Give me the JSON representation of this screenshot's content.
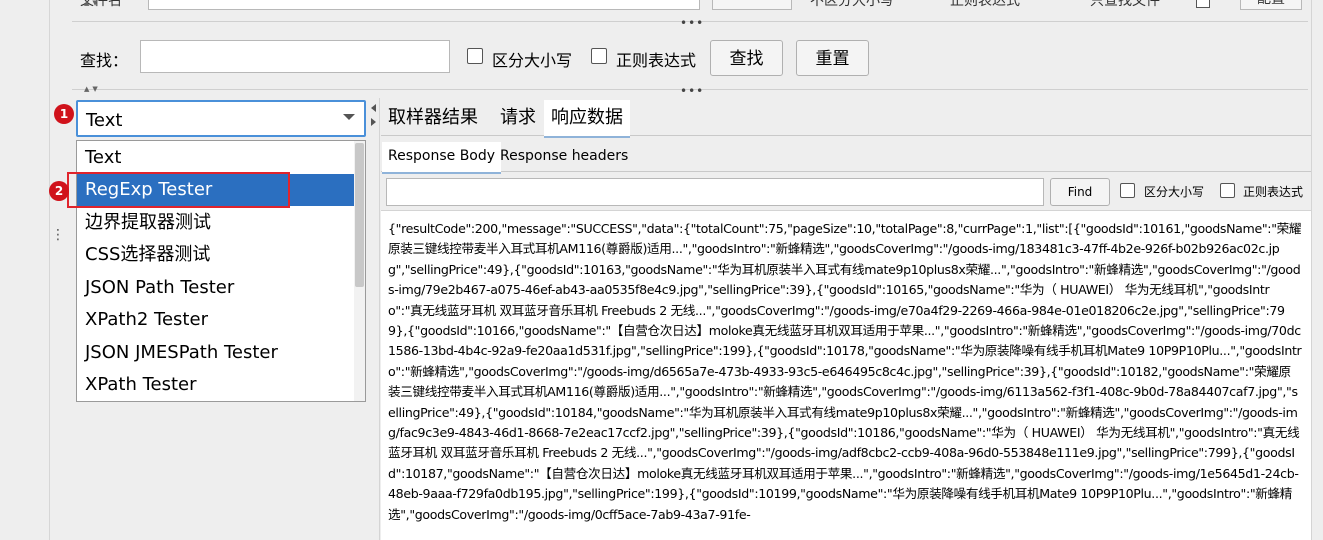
{
  "top_row": {
    "cut_label_1": "文件名",
    "cut_label_2": "不区分大小写",
    "cut_label_3": "正则表达式",
    "cut_label_4": "只查找文件",
    "cut_button": "配置"
  },
  "search": {
    "label": "查找：",
    "input_value": "",
    "case_label": "区分大小写",
    "regex_label": "正则表达式",
    "find_button": "查找",
    "reset_button": "重置"
  },
  "renderer_select": {
    "selected": "Text",
    "options": [
      "Text",
      "RegExp Tester",
      "边界提取器测试",
      "CSS选择器测试",
      "JSON Path Tester",
      "XPath2 Tester",
      "JSON JMESPath Tester",
      "XPath Tester"
    ],
    "highlighted_index": 1
  },
  "annotations": {
    "badge_1": "1",
    "badge_2": "2",
    "color_marker": "#e0242c"
  },
  "tabs": [
    {
      "label": "取样器结果",
      "active": false
    },
    {
      "label": "请求",
      "active": false
    },
    {
      "label": "响应数据",
      "active": true
    }
  ],
  "subtabs": [
    {
      "label": "Response Body",
      "active": true
    },
    {
      "label": "Response headers",
      "active": false
    }
  ],
  "response_find": {
    "input_value": "",
    "find_button": "Find",
    "case_label": "区分大小写",
    "regex_label": "正则表达式"
  },
  "response_body": "{\"resultCode\":200,\"message\":\"SUCCESS\",\"data\":{\"totalCount\":75,\"pageSize\":10,\"totalPage\":8,\"currPage\":1,\"list\":[{\"goodsId\":10161,\"goodsName\":\"荣耀原装三键线控带麦半入耳式耳机AM116(尊爵版)适用...\",\"goodsIntro\":\"新蜂精选\",\"goodsCoverImg\":\"/goods-img/183481c3-47ff-4b2e-926f-b02b926ac02c.jpg\",\"sellingPrice\":49},{\"goodsId\":10163,\"goodsName\":\"华为耳机原装半入耳式有线mate9p10plus8x荣耀...\",\"goodsIntro\":\"新蜂精选\",\"goodsCoverImg\":\"/goods-img/79e2b467-a075-46ef-ab43-aa0535f8e4c9.jpg\",\"sellingPrice\":39},{\"goodsId\":10165,\"goodsName\":\"华为（ HUAWEI） 华为无线耳机\",\"goodsIntro\":\"真无线蓝牙耳机 双耳蓝牙音乐耳机 Freebuds 2 无线...\",\"goodsCoverImg\":\"/goods-img/e70a4f29-2269-466a-984e-01e018206c2e.jpg\",\"sellingPrice\":799},{\"goodsId\":10166,\"goodsName\":\"【自营仓次日达】moloke真无线蓝牙耳机双耳适用于苹果...\",\"goodsIntro\":\"新蜂精选\",\"goodsCoverImg\":\"/goods-img/70dc1586-13bd-4b4c-92a9-fe20aa1d531f.jpg\",\"sellingPrice\":199},{\"goodsId\":10178,\"goodsName\":\"华为原装降噪有线手机耳机Mate9 10P9P10Plu...\",\"goodsIntro\":\"新蜂精选\",\"goodsCoverImg\":\"/goods-img/d6565a7e-473b-4933-93c5-e646495c8c4c.jpg\",\"sellingPrice\":39},{\"goodsId\":10182,\"goodsName\":\"荣耀原装三键线控带麦半入耳式耳机AM116(尊爵版)适用...\",\"goodsIntro\":\"新蜂精选\",\"goodsCoverImg\":\"/goods-img/6113a562-f3f1-408c-9b0d-78a84407caf7.jpg\",\"sellingPrice\":49},{\"goodsId\":10184,\"goodsName\":\"华为耳机原装半入耳式有线mate9p10plus8x荣耀...\",\"goodsIntro\":\"新蜂精选\",\"goodsCoverImg\":\"/goods-img/fac9c3e9-4843-46d1-8668-7e2eac17ccf2.jpg\",\"sellingPrice\":39},{\"goodsId\":10186,\"goodsName\":\"华为（ HUAWEI） 华为无线耳机\",\"goodsIntro\":\"真无线蓝牙耳机 双耳蓝牙音乐耳机 Freebuds 2 无线...\",\"goodsCoverImg\":\"/goods-img/adf8cbc2-ccb9-408a-96d0-553848e111e9.jpg\",\"sellingPrice\":799},{\"goodsId\":10187,\"goodsName\":\"【自营仓次日达】moloke真无线蓝牙耳机双耳适用于苹果...\",\"goodsIntro\":\"新蜂精选\",\"goodsCoverImg\":\"/goods-img/1e5645d1-24cb-48eb-9aaa-f729fa0db195.jpg\",\"sellingPrice\":199},{\"goodsId\":10199,\"goodsName\":\"华为原装降噪有线手机耳机Mate9 10P9P10Plu...\",\"goodsIntro\":\"新蜂精选\",\"goodsCoverImg\":\"/goods-img/0cff5ace-7ab9-43a7-91fe-"
}
